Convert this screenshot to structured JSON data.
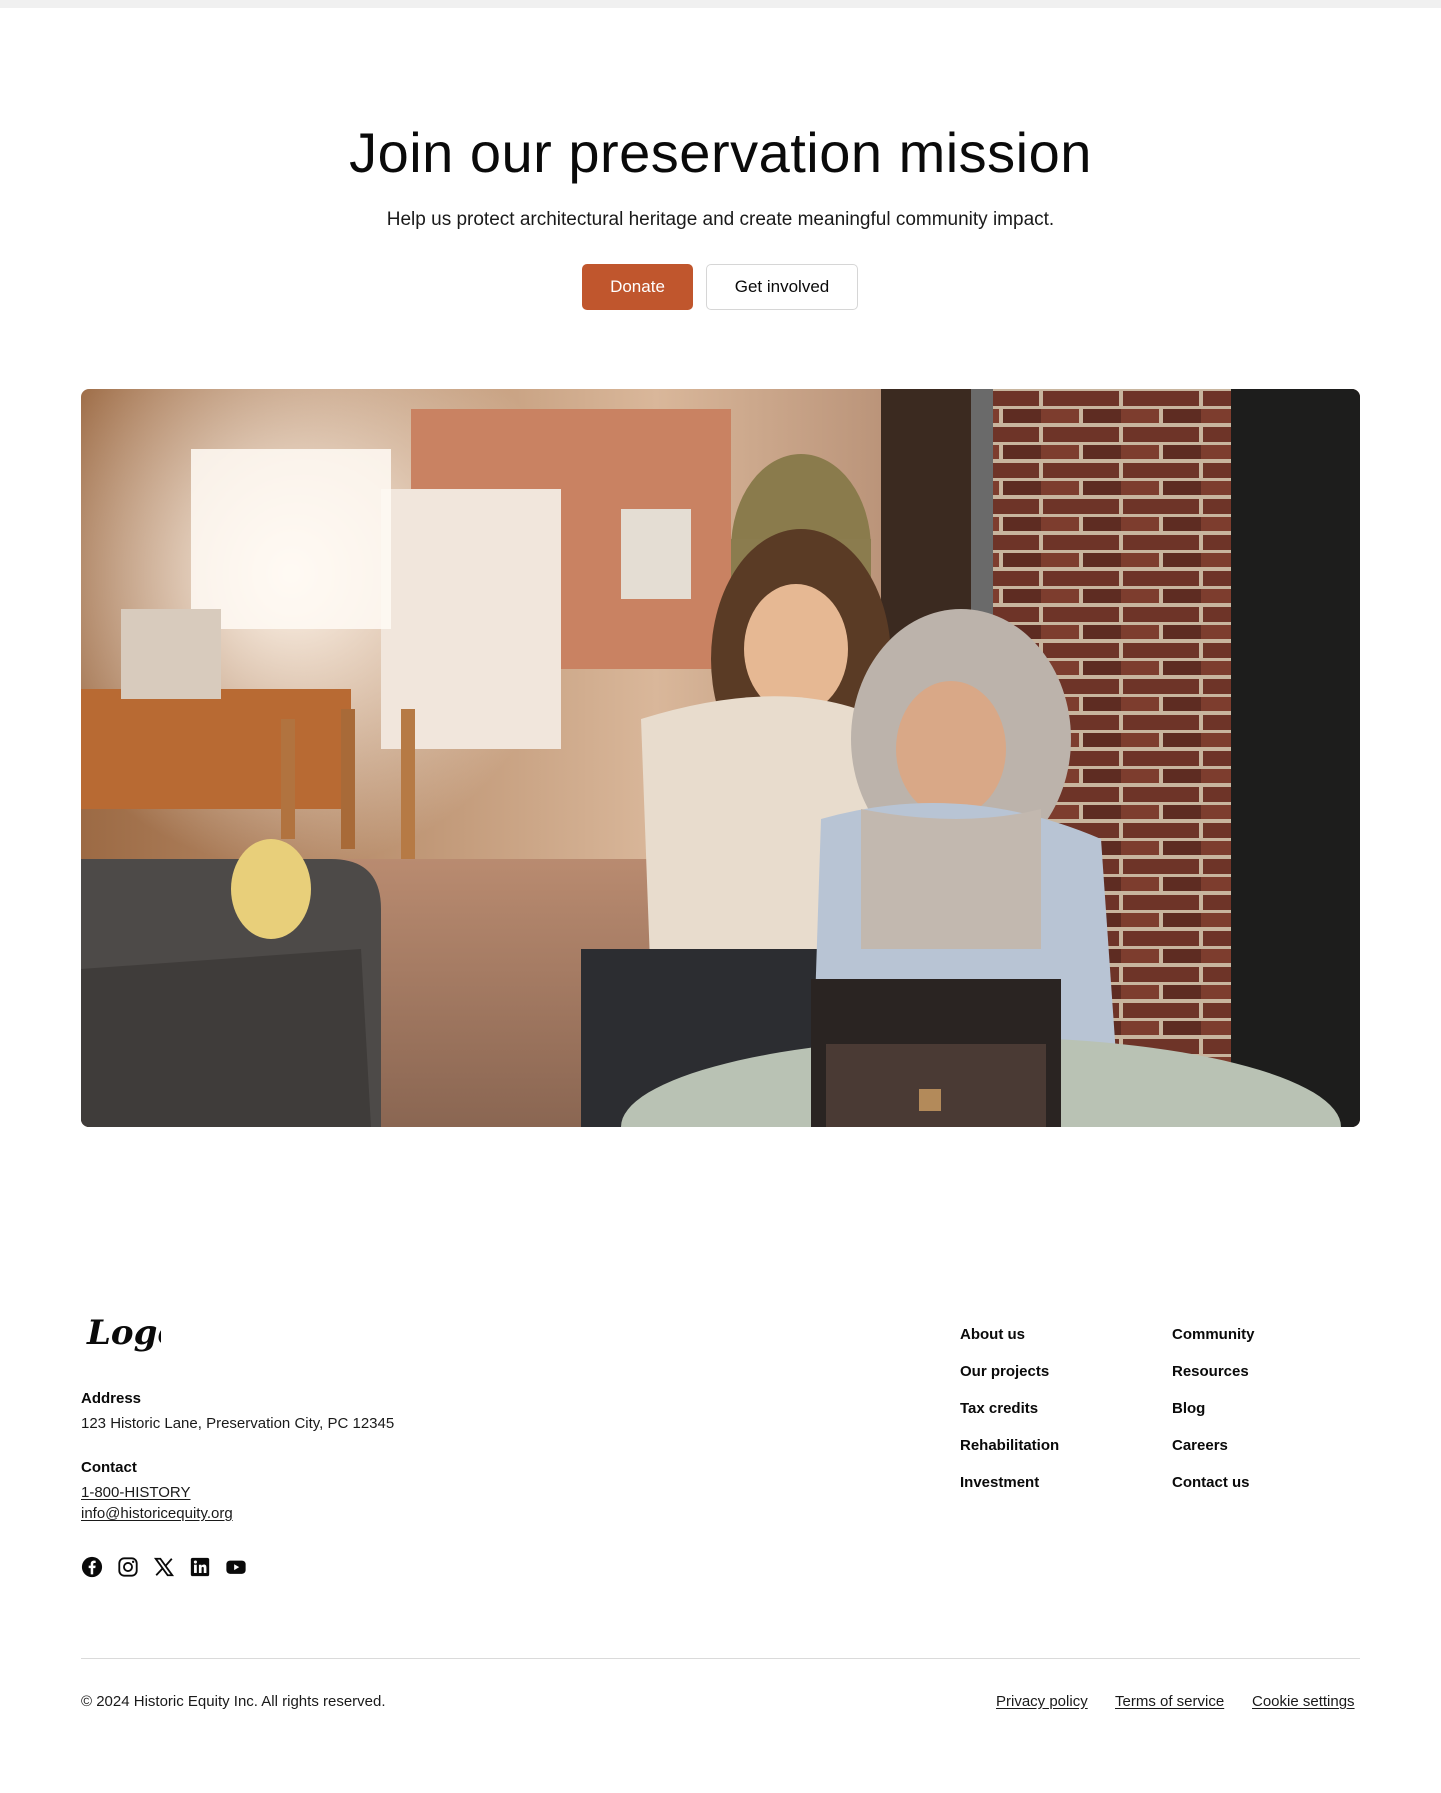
{
  "cta": {
    "title": "Join our preservation mission",
    "subtitle": "Help us protect architectural heritage and create meaningful community impact.",
    "primary_button": "Donate",
    "secondary_button": "Get involved",
    "accent_color": "#c0562d"
  },
  "footer": {
    "logo_text": "Logo",
    "address_label": "Address",
    "address_value": "123 Historic Lane, Preservation City, PC 12345",
    "contact_label": "Contact",
    "phone": "1-800-HISTORY",
    "email": "info@historicequity.org",
    "socials": [
      "facebook-icon",
      "instagram-icon",
      "x-icon",
      "linkedin-icon",
      "youtube-icon"
    ],
    "nav_col1": [
      "About us",
      "Our projects",
      "Tax credits",
      "Rehabilitation",
      "Investment"
    ],
    "nav_col2": [
      "Community",
      "Resources",
      "Blog",
      "Careers",
      "Contact us"
    ],
    "copyright": "© 2024 Historic Equity Inc. All rights reserved.",
    "legal": [
      "Privacy policy",
      "Terms of service",
      "Cookie settings"
    ]
  }
}
